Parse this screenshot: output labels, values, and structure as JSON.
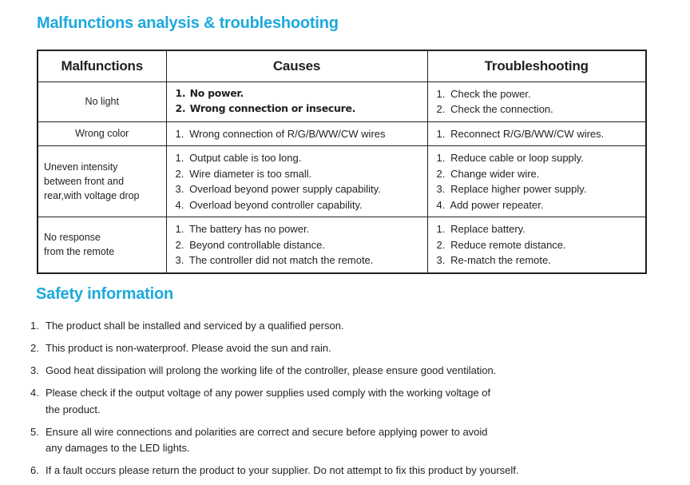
{
  "headings": {
    "malfunctions": "Malfunctions analysis & troubleshooting",
    "safety": "Safety information"
  },
  "colors": {
    "heading": "#1CA9DE",
    "text": "#231f20",
    "border": "#231f20",
    "background": "#ffffff"
  },
  "table": {
    "columns": [
      "Malfunctions",
      "Causes",
      "Troubleshooting"
    ],
    "rows": [
      {
        "malfunction": "No light",
        "malfunction_lines": [
          "No light"
        ],
        "align": "center",
        "causes": [
          "No power.",
          "Wrong connection or insecure."
        ],
        "troubleshooting": [
          "Check the power.",
          "Check the connection."
        ]
      },
      {
        "malfunction": "Wrong color",
        "malfunction_lines": [
          "Wrong color"
        ],
        "align": "center",
        "causes": [
          "Wrong connection of R/G/B/WW/CW wires"
        ],
        "troubleshooting": [
          "Reconnect R/G/B/WW/CW wires."
        ]
      },
      {
        "malfunction": "Uneven intensity between front and rear,with voltage drop",
        "malfunction_lines": [
          "Uneven intensity",
          "between front and",
          "rear,with voltage drop"
        ],
        "align": "left",
        "causes": [
          "Output cable is too long.",
          "Wire diameter is too small.",
          "Overload beyond power supply capability.",
          "Overload beyond controller capability."
        ],
        "troubleshooting": [
          "Reduce cable or loop supply.",
          "Change wider wire.",
          "Replace higher power supply.",
          "Add power repeater."
        ]
      },
      {
        "malfunction": "No response from the remote",
        "malfunction_lines": [
          "No response",
          "from the remote"
        ],
        "align": "left",
        "causes": [
          "The battery has no power.",
          "Beyond controllable distance.",
          "The controller did not match the remote."
        ],
        "troubleshooting": [
          "Replace battery.",
          "Reduce remote distance.",
          "Re-match the remote."
        ]
      }
    ]
  },
  "safety": {
    "items": [
      {
        "num": "1.",
        "lines": [
          "The product shall be installed and serviced by a qualified person."
        ]
      },
      {
        "num": "2.",
        "lines": [
          "This product is non-waterproof. Please avoid the sun and rain."
        ]
      },
      {
        "num": "3.",
        "lines": [
          "Good heat dissipation will prolong the working life of the controller, please ensure good ventilation."
        ]
      },
      {
        "num": "4.",
        "lines": [
          "Please check if the output voltage of any power supplies used comply with the working voltage of",
          "the product."
        ]
      },
      {
        "num": "5.",
        "lines": [
          "Ensure all wire connections and polarities are correct and secure before applying power to avoid",
          "any damages to the LED lights."
        ]
      },
      {
        "num": "6.",
        "lines": [
          "If a fault occurs please return the product to your supplier. Do not attempt to fix this product by yourself."
        ]
      }
    ]
  }
}
